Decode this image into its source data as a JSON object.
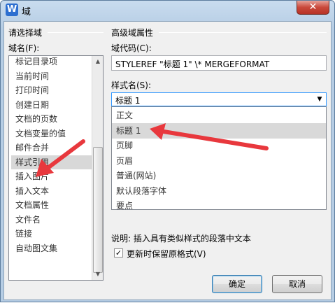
{
  "window": {
    "title": "域",
    "app_icon_letter": "W",
    "close_glyph": "✕"
  },
  "left": {
    "group_title": "请选择域",
    "field_names_label": "域名(F):",
    "items": [
      "标记目录项",
      "当前时间",
      "打印时间",
      "创建日期",
      "文档的页数",
      "文档变量的值",
      "邮件合并",
      "样式引用",
      "插入图片",
      "插入文本",
      "文档属性",
      "文件名",
      "链接",
      "自动图文集"
    ],
    "selected_index": 7
  },
  "right": {
    "group_title": "高级域属性",
    "field_code_label": "域代码(C):",
    "field_code_value": "STYLEREF \"标题 1\" \\* MERGEFORMAT",
    "style_name_label": "样式名(S):",
    "style_selected": "标题 1",
    "style_options": [
      "正文",
      "标题 1",
      "页脚",
      "页眉",
      "普通(网站)",
      "默认段落字体",
      "要点"
    ],
    "highlighted_index": 1,
    "description": "说明: 插入具有类似样式的段落中文本",
    "preserve_format_label": "更新时保留原格式(V)",
    "preserve_format_checked": true
  },
  "buttons": {
    "ok": "确定",
    "cancel": "取消"
  },
  "annotation_color": "#e8383d"
}
